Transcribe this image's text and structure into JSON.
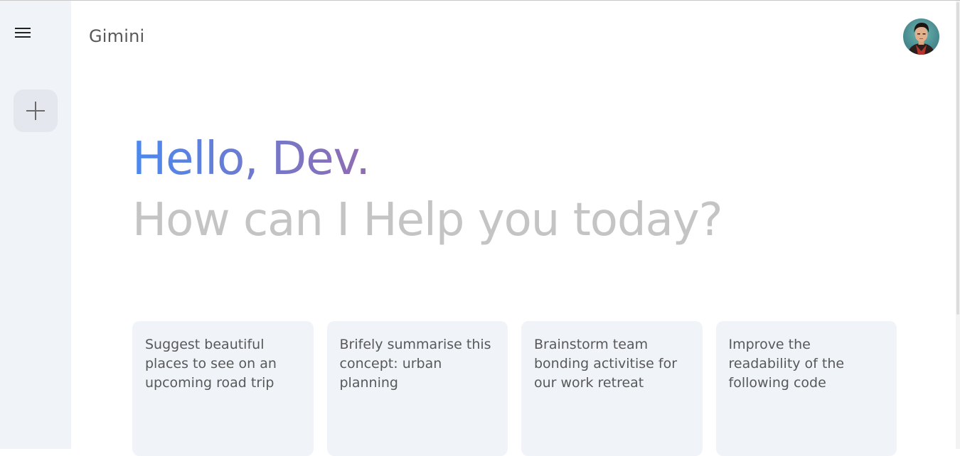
{
  "app": {
    "title": "Gimini"
  },
  "sidebar": {
    "menu_icon": "hamburger-menu-icon",
    "new_chat_icon": "plus-icon"
  },
  "header": {
    "avatar_icon": "user-avatar"
  },
  "greeting": {
    "hello": "Hello, Dev.",
    "subtitle": "How can I Help you today?"
  },
  "cards": [
    {
      "text": "Suggest beautiful places to see on an upcoming road trip"
    },
    {
      "text": "Brifely summarise this concept: urban planning"
    },
    {
      "text": "Brainstorm team bonding activitise for our work retreat"
    },
    {
      "text": "Improve the readability of the following code"
    }
  ],
  "colors": {
    "sidebar_bg": "#f0f4f9",
    "card_bg": "#f0f4f9",
    "gradient_start": "#4b89f0",
    "gradient_end": "#f0453f",
    "muted_text": "#c4c4c4"
  }
}
